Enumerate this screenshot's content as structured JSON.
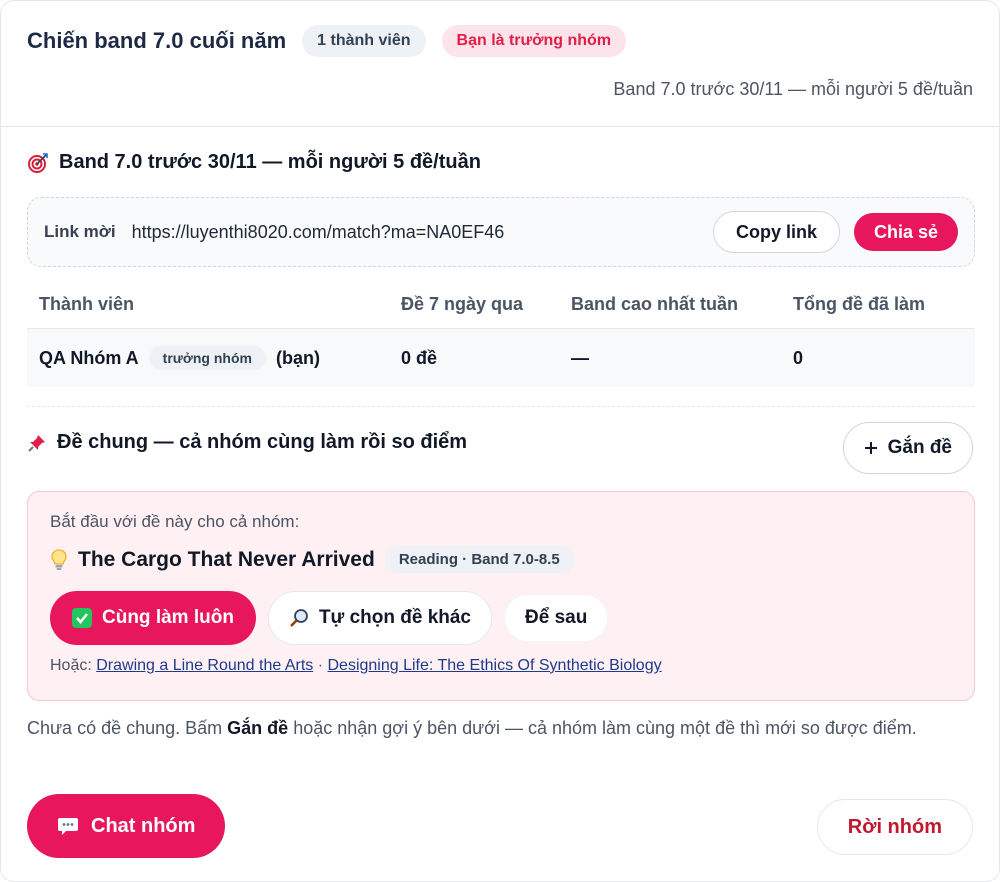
{
  "group": {
    "title": "Chiến band 7.0 cuối năm",
    "member_count": "1 thành viên",
    "leader_badge": "Bạn là trưởng nhóm",
    "goal_summary": "Band 7.0 trước 30/11 — mỗi người 5 đề/tuần"
  },
  "goal": {
    "icon": "target-icon",
    "text": "Band 7.0 trước 30/11 — mỗi người 5 đề/tuần"
  },
  "invite": {
    "label": "Link mời",
    "url": "https://luyenthi8020.com/match?ma=NA0EF46",
    "copy_label": "Copy link",
    "share_label": "Chia sẻ"
  },
  "members_table": {
    "headers": [
      "Thành viên",
      "Đề 7 ngày qua",
      "Band cao nhất tuần",
      "Tổng đề đã làm"
    ],
    "rows": [
      {
        "name": "QA Nhóm A",
        "role": "trưởng nhóm",
        "you": "(bạn)",
        "tests_7d": "0 đề",
        "best_band": "—",
        "total": "0"
      }
    ]
  },
  "shared": {
    "icon": "pin-icon",
    "title": "Đề chung — cả nhóm cùng làm rồi so điểm",
    "attach_label": "Gắn đề",
    "suggestion": {
      "lead": "Bắt đầu với đề này cho cả nhóm:",
      "test_icon": "lightbulb-icon",
      "test_title": "The Cargo That Never Arrived",
      "test_tag": "Reading · Band 7.0-8.5",
      "do_now_label": "Cùng làm luôn",
      "choose_other_label": "Tự chọn đề khác",
      "later_label": "Để sau",
      "alt_prefix": "Hoặc:",
      "alt_links": [
        "Drawing a Line Round the Arts",
        "Designing Life: The Ethics Of Synthetic Biology"
      ],
      "alt_separator": "·"
    },
    "empty_note_before": "Chưa có đề chung. Bấm ",
    "empty_note_bold": "Gắn đề",
    "empty_note_after": " hoặc nhận gợi ý bên dưới — cả nhóm làm cùng một đề thì mới so được điểm."
  },
  "footer": {
    "chat_label": "Chat nhóm",
    "leave_label": "Rời nhóm"
  },
  "colors": {
    "accent": "#e8175d",
    "danger_text": "#c0182f",
    "suggestion_bg": "#fff0f3"
  }
}
